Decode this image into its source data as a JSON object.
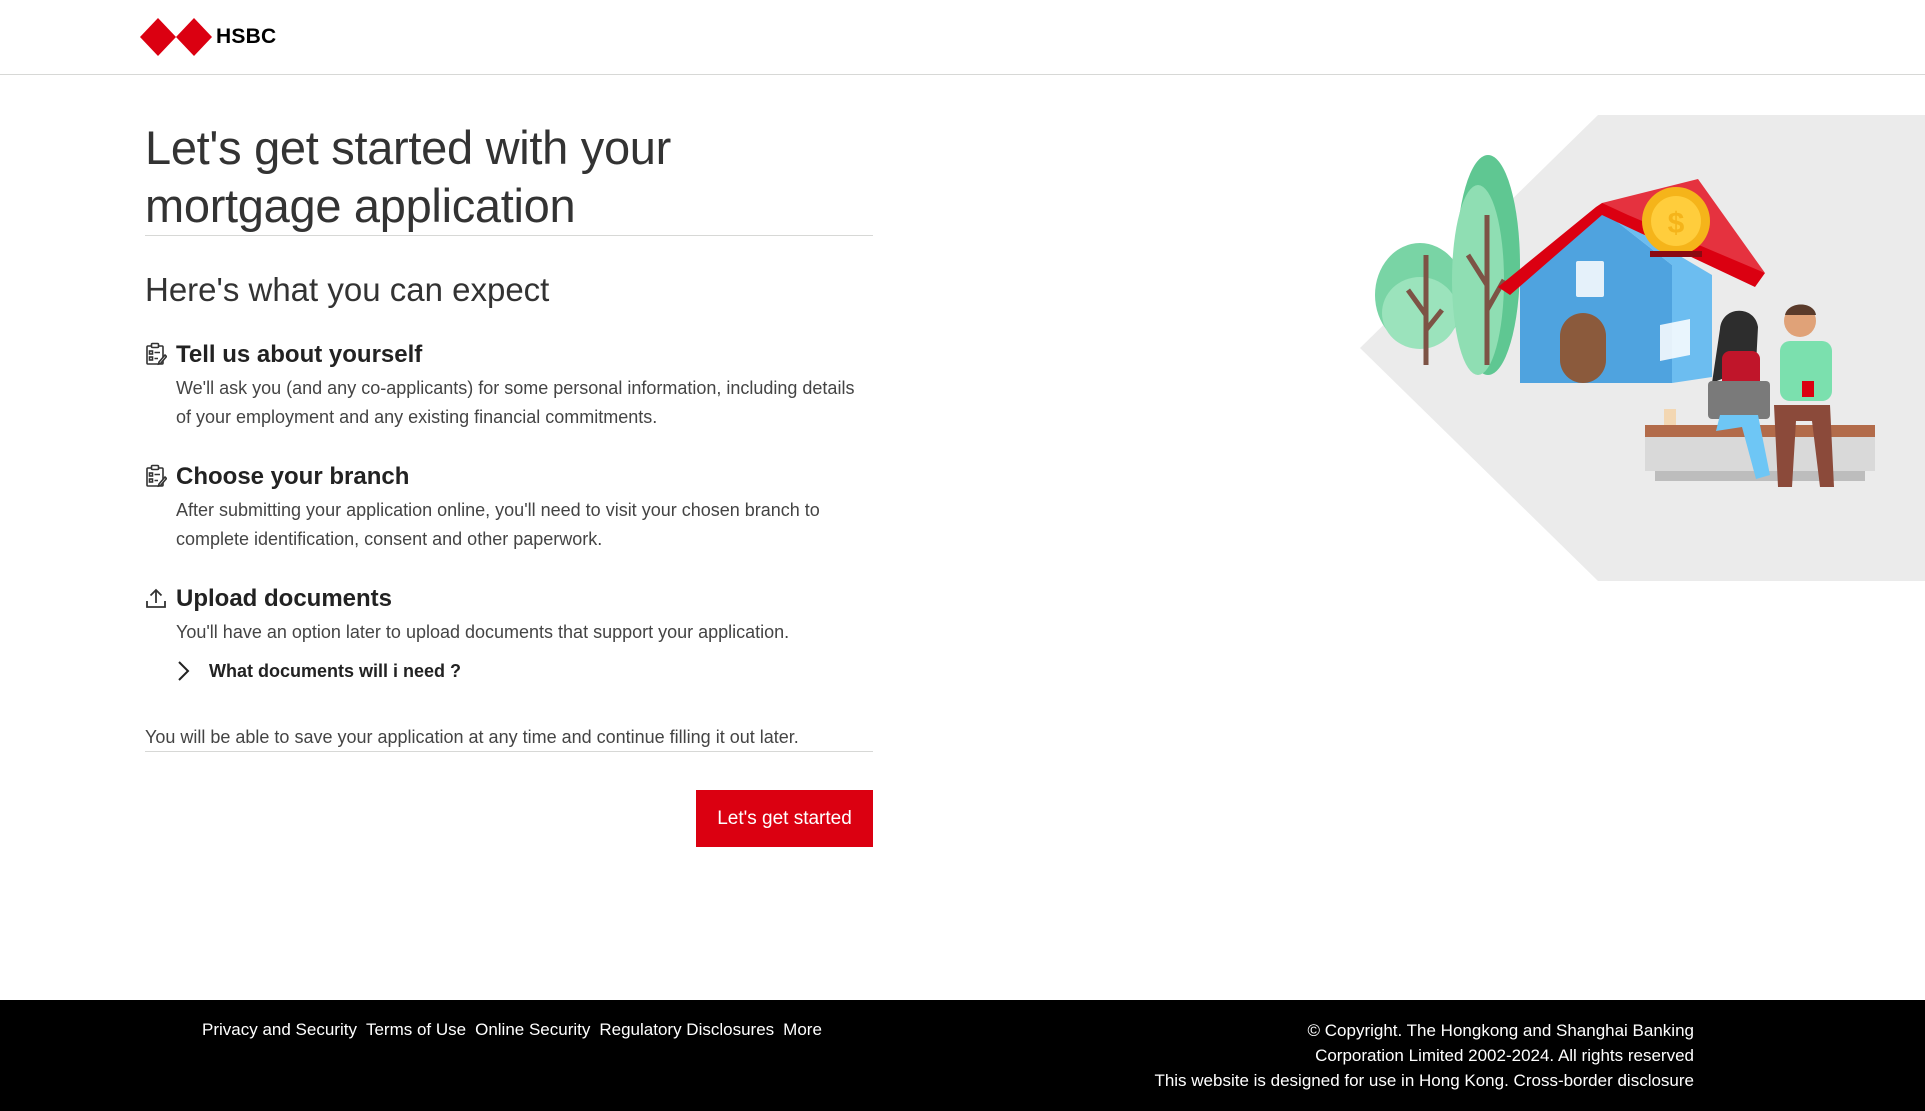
{
  "header": {
    "brand_name": "HSBC",
    "brand_color": "#db0011"
  },
  "main": {
    "title": "Let's get started with your mortgage application",
    "subtitle": "Here's what you can expect",
    "steps": [
      {
        "icon": "clipboard-checklist-icon",
        "title": "Tell us about yourself",
        "text": "We'll ask you (and any co-applicants) for some personal information, including details of your employment and any existing financial commitments."
      },
      {
        "icon": "clipboard-checklist-icon",
        "title": "Choose your branch",
        "text": "After submitting your application online, you'll need to visit your chosen branch to complete identification, consent and other paperwork."
      },
      {
        "icon": "upload-icon",
        "title": "Upload documents",
        "text": "You'll have an option later to upload documents that support your application."
      }
    ],
    "expander_label": "What documents will i need ?",
    "save_note": "You will be able to save your application at any time and continue filling it out later.",
    "cta_label": "Let's get started",
    "cta_color": "#db0011"
  },
  "footer": {
    "links": [
      "Privacy and Security",
      "Terms of Use",
      "Online Security",
      "Regulatory Disclosures",
      "More"
    ],
    "copyright_line1": "© Copyright. The Hongkong and Shanghai Banking",
    "copyright_line2": "Corporation Limited 2002-2024. All rights reserved",
    "hk_notice": "This website is designed for use in Hong Kong.",
    "cross_border": "Cross-border disclosure"
  }
}
